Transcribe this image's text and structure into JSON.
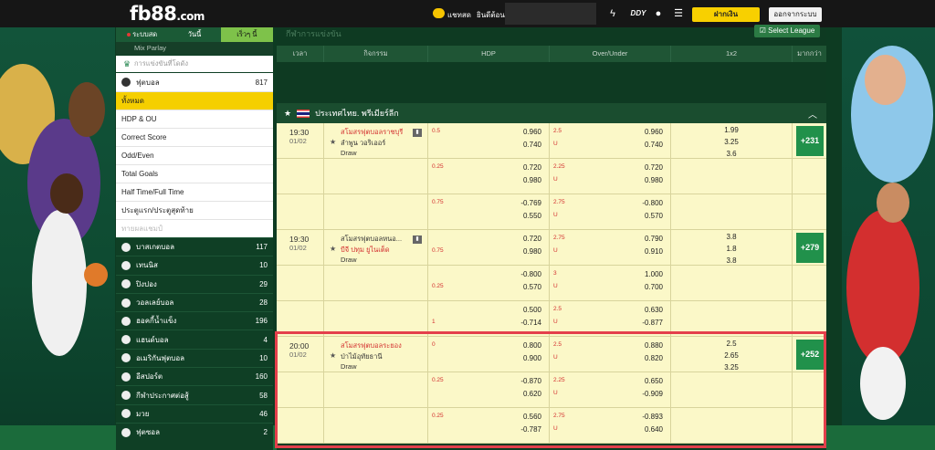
{
  "header": {
    "logo": "fb88",
    "logo_suffix": ".com",
    "chat_label": "แชทสด",
    "welcome_label": "ยินดีต้อนรั",
    "deposit_label": "ฝากเงิน",
    "withdraw_label": "ออกจากระบบ",
    "icons": [
      "lightning-icon",
      "ddy-icon",
      "user-icon",
      "list-icon",
      "settings-icon"
    ]
  },
  "sidebar": {
    "tabs": [
      {
        "label": "ระบบสด",
        "active": false
      },
      {
        "label": "วันนี้",
        "active": false
      },
      {
        "label": "เร็วๆ นี้",
        "active": true
      }
    ],
    "parlay_label": "Mix Parlay",
    "search_placeholder": "การแข่งขันที่โดดัง",
    "football": {
      "label": "ฟุตบอล",
      "count": "817"
    },
    "sub_items": [
      {
        "label": "ทั้งหมด",
        "active": true
      },
      {
        "label": "HDP & OU",
        "active": false
      },
      {
        "label": "Correct Score",
        "active": false
      },
      {
        "label": "Odd/Even",
        "active": false
      },
      {
        "label": "Total Goals",
        "active": false
      },
      {
        "label": "Half Time/Full Time",
        "active": false
      },
      {
        "label": "ประตูแรก/ประตูสุดท้าย",
        "active": false
      },
      {
        "label": "ทายผลแชมป์",
        "active": false,
        "disabled": true
      }
    ],
    "sports": [
      {
        "label": "บาสเกตบอล",
        "count": "117"
      },
      {
        "label": "เทนนิส",
        "count": "10"
      },
      {
        "label": "ปิงปอง",
        "count": "29"
      },
      {
        "label": "วอลเลย์บอล",
        "count": "28"
      },
      {
        "label": "ฮอคกี้น้ำแข็ง",
        "count": "196"
      },
      {
        "label": "แฮนด์บอล",
        "count": "4"
      },
      {
        "label": "อเมริกันฟุตบอล",
        "count": "10"
      },
      {
        "label": "อีสปอร์ต",
        "count": "160"
      },
      {
        "label": "กีฬาประกาศต่อสู้",
        "count": "58"
      },
      {
        "label": "มวย",
        "count": "46"
      },
      {
        "label": "ฟุตซอล",
        "count": "2"
      }
    ]
  },
  "main": {
    "title": "กีฬาการแข่งขัน",
    "select_league_label": "Select League",
    "columns": [
      "เวลา",
      "กิจกรรม",
      "HDP",
      "Over/Under",
      "1x2",
      "มากกว่า"
    ],
    "league": "ประเทศไทย. พรีเมียร์ลีก",
    "matches": [
      {
        "time": "19:30",
        "date": "01/02",
        "home": "สโมสรฟุตบอลราชบุรี",
        "away": "ลำพูน วอริเออร์",
        "draw": "Draw",
        "x12": [
          "1.99",
          "3.25",
          "3.6"
        ],
        "more": "+231",
        "lines": [
          {
            "hdp_line": "0.5",
            "hdp": [
              "0.960",
              "0.740"
            ],
            "ou_line": "2.5",
            "ou": [
              "0.960",
              "0.740"
            ]
          },
          {
            "hdp_line": "0.25",
            "hdp": [
              "0.720",
              "0.980"
            ],
            "ou_line": "2.25",
            "ou": [
              "0.720",
              "0.980"
            ]
          },
          {
            "hdp_line": "0.75",
            "hdp": [
              "-0.769",
              "0.550"
            ],
            "ou_line": "2.75",
            "ou": [
              "-0.800",
              "0.570"
            ]
          }
        ]
      },
      {
        "time": "19:30",
        "date": "01/02",
        "home": "สโมสรฟุตบอลหนอ...",
        "away": "บีจี ปทุม ยูไนเต็ด",
        "draw": "Draw",
        "x12": [
          "3.8",
          "1.8",
          "3.8"
        ],
        "more": "+279",
        "lines": [
          {
            "hdp_line": "0.75",
            "hdp": [
              "0.720",
              "0.980"
            ],
            "ou_line": "2.75",
            "ou": [
              "0.790",
              "0.910"
            ]
          },
          {
            "hdp_line": "0.25",
            "hdp": [
              "-0.800",
              "0.570"
            ],
            "ou_line": "3",
            "ou": [
              "1.000",
              "0.700"
            ]
          },
          {
            "hdp_line": "1",
            "hdp": [
              "0.500",
              "-0.714"
            ],
            "ou_line": "2.5",
            "ou": [
              "0.630",
              "-0.877"
            ]
          }
        ]
      },
      {
        "time": "20:00",
        "date": "01/02",
        "home": "สโมสรฟุตบอลระยอง",
        "away": "ป่าไม้อุทัยธานี",
        "draw": "Draw",
        "x12": [
          "2.5",
          "2.65",
          "3.25"
        ],
        "more": "+252",
        "lines": [
          {
            "hdp_line": "0",
            "hdp": [
              "0.800",
              "0.900"
            ],
            "ou_line": "2.5",
            "ou": [
              "0.880",
              "0.820"
            ]
          },
          {
            "hdp_line": "0.25",
            "hdp": [
              "-0.870",
              "0.620"
            ],
            "ou_line": "2.25",
            "ou": [
              "0.650",
              "-0.909"
            ]
          },
          {
            "hdp_line": "0.25",
            "hdp": [
              "0.560",
              "-0.787"
            ],
            "ou_line": "2.75",
            "ou": [
              "-0.893",
              "0.640"
            ]
          }
        ]
      }
    ],
    "ou_labels": {
      "over": "O",
      "under": "U"
    }
  },
  "colors": {
    "accent_yellow": "#f5cf00",
    "bg_green": "#0e3a22",
    "row_yellow": "#fbf8c8",
    "highlight_red": "#e43f4b",
    "more_green": "#21914b"
  }
}
